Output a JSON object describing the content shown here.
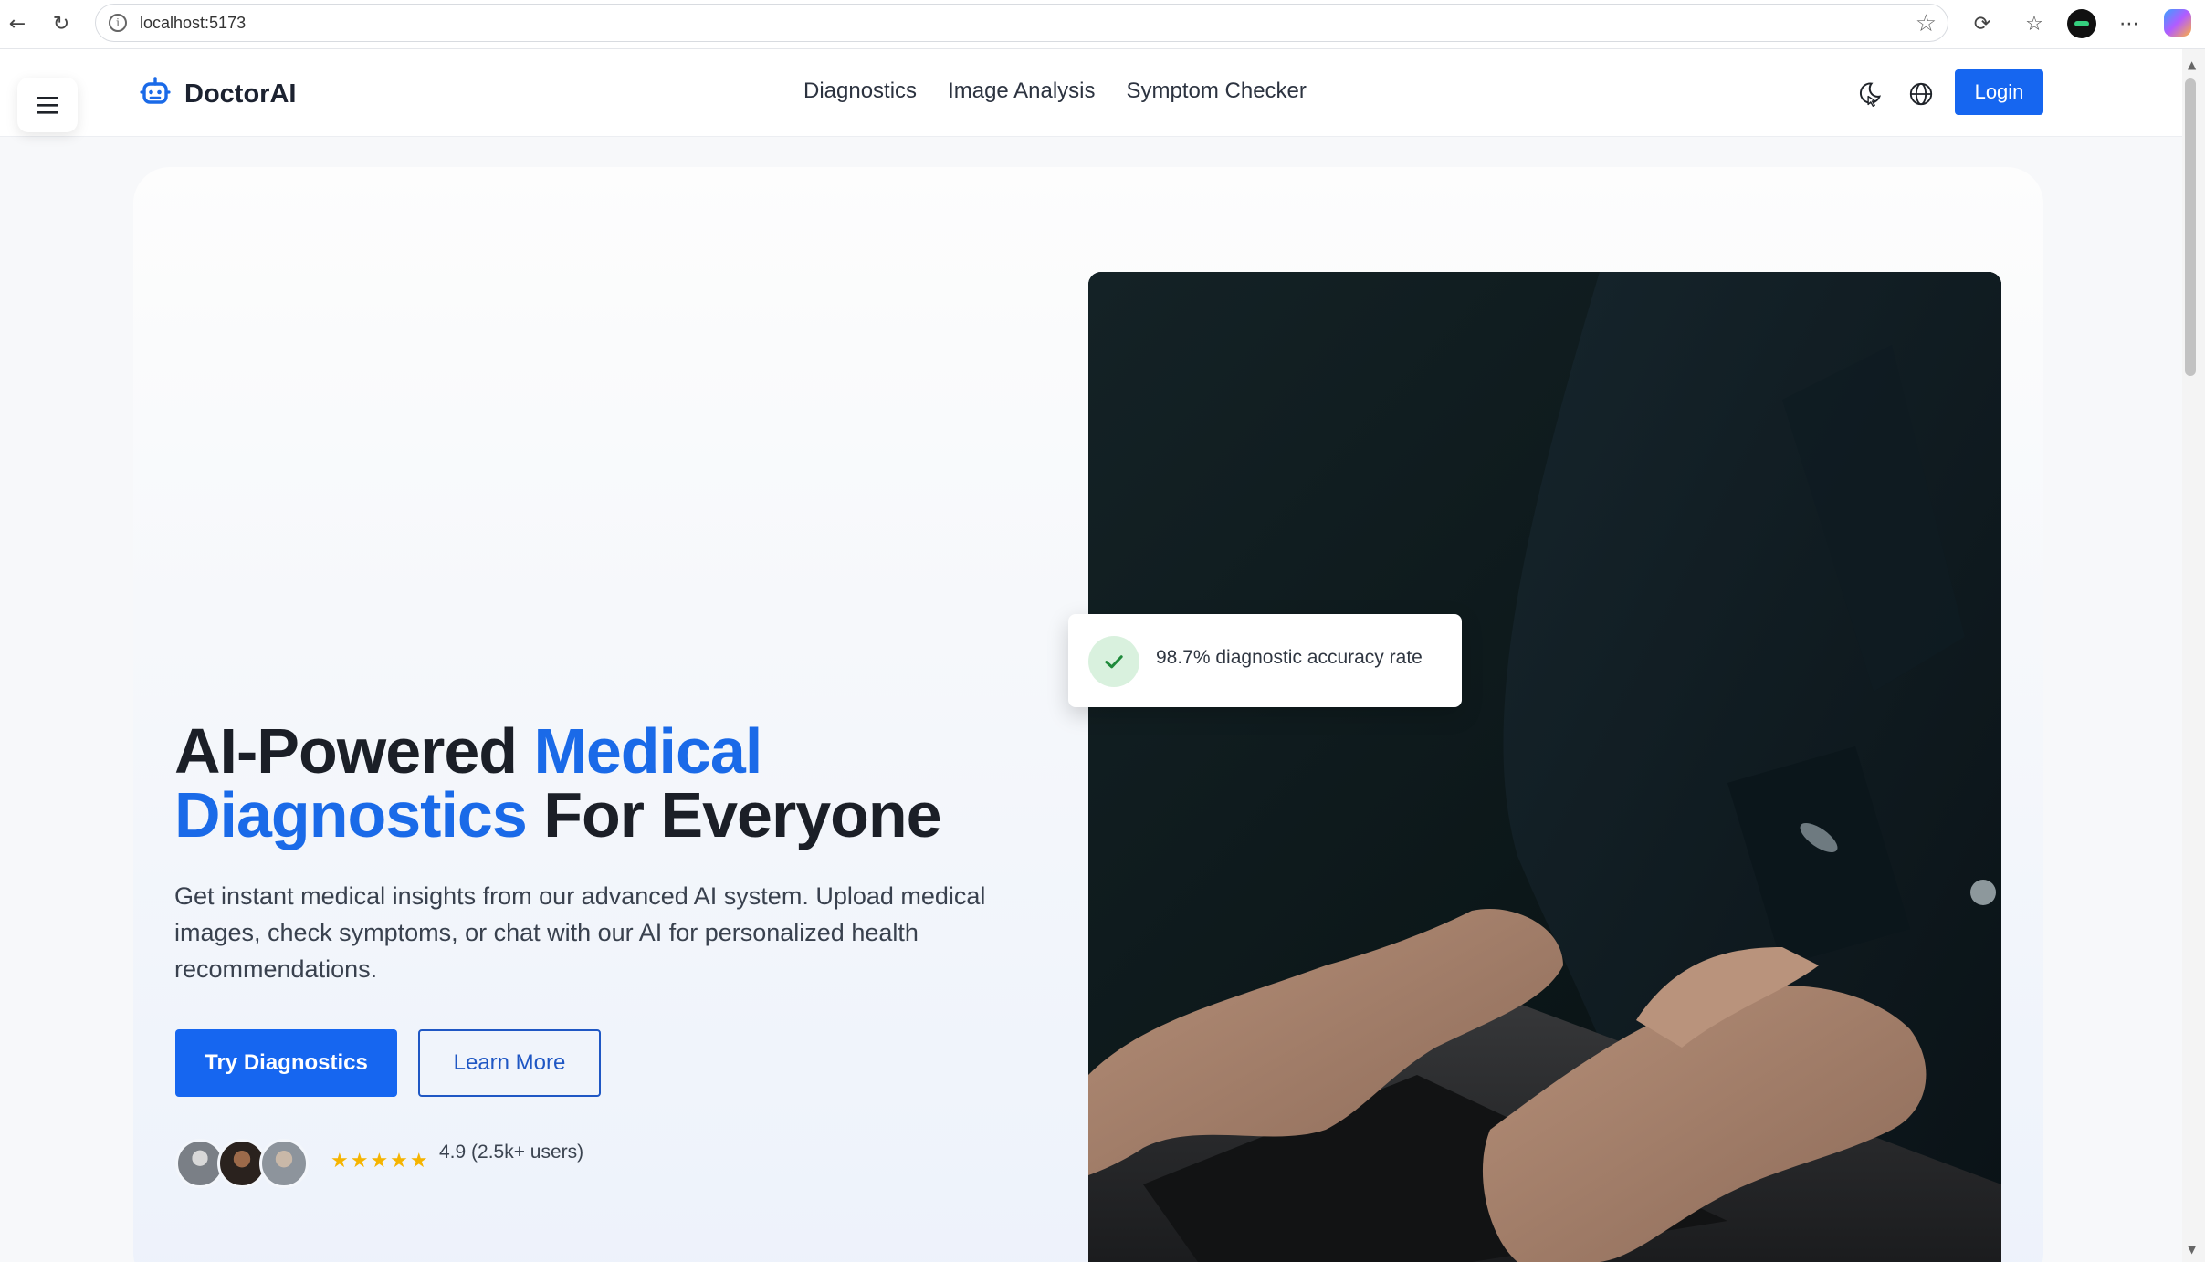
{
  "browser": {
    "url": "localhost:5173"
  },
  "header": {
    "logo_text": "DoctorAI",
    "nav": [
      {
        "label": "Diagnostics"
      },
      {
        "label": "Image Analysis"
      },
      {
        "label": "Symptom Checker"
      }
    ],
    "login_label": "Login"
  },
  "hero": {
    "title_part1": "AI-Powered ",
    "title_accent1": "Medical",
    "title_accent2": "Diagnostics",
    "title_part2": " For Everyone",
    "subtitle": "Get instant medical insights from our advanced AI system. Upload medical images, check symptoms, or chat with our AI for personalized health recommendations.",
    "primary_button": "Try Diagnostics",
    "secondary_button": "Learn More",
    "stars": "★★★★★",
    "rating_text": "4.9 (2.5k+ users)",
    "badge_text": "98.7% diagnostic accuracy rate"
  },
  "colors": {
    "accent": "#1a6ae8",
    "button": "#1666f0",
    "star": "#f5b400",
    "check_bg": "#d9f1de",
    "check": "#1f8a3b"
  },
  "icons": {
    "menu": "hamburger-menu-icon",
    "logo": "robot-logo-icon",
    "theme": "theme-toggle-icon",
    "language": "globe-icon",
    "badge": "check-icon"
  }
}
